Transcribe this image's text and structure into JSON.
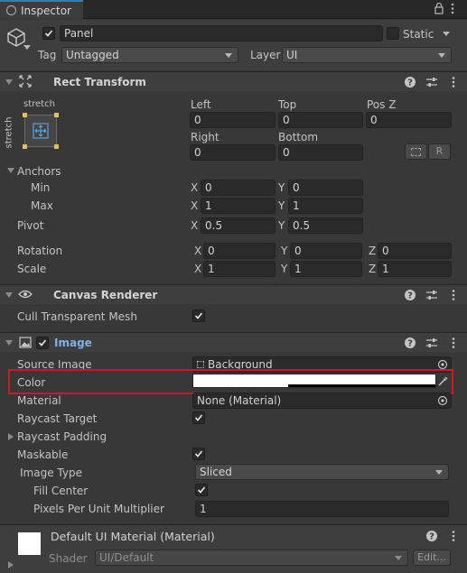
{
  "tab": {
    "title": "Inspector"
  },
  "gameobject": {
    "name": "Panel",
    "static_label": "Static",
    "tag_label": "Tag",
    "tag_value": "Untagged",
    "layer_label": "Layer",
    "layer_value": "UI"
  },
  "rect_transform": {
    "title": "Rect Transform",
    "anchor_preset_h": "stretch",
    "anchor_preset_v": "stretch",
    "left_label": "Left",
    "left_value": "0",
    "top_label": "Top",
    "top_value": "0",
    "posz_label": "Pos Z",
    "posz_value": "0",
    "right_label": "Right",
    "right_value": "0",
    "bottom_label": "Bottom",
    "bottom_value": "0",
    "r_button": "R",
    "anchors_label": "Anchors",
    "min_label": "Min",
    "min_x": "0",
    "min_y": "0",
    "max_label": "Max",
    "max_x": "1",
    "max_y": "1",
    "pivot_label": "Pivot",
    "pivot_x": "0.5",
    "pivot_y": "0.5",
    "rotation_label": "Rotation",
    "rot_x": "0",
    "rot_y": "0",
    "rot_z": "0",
    "scale_label": "Scale",
    "scale_x": "1",
    "scale_y": "1",
    "scale_z": "1",
    "x": "X",
    "y": "Y",
    "z": "Z"
  },
  "canvas_renderer": {
    "title": "Canvas Renderer",
    "cull_label": "Cull Transparent Mesh"
  },
  "image": {
    "title": "Image",
    "source_label": "Source Image",
    "source_value": "Background",
    "color_label": "Color",
    "material_label": "Material",
    "material_value": "None (Material)",
    "raycast_target_label": "Raycast Target",
    "raycast_padding_label": "Raycast Padding",
    "maskable_label": "Maskable",
    "image_type_label": "Image Type",
    "image_type_value": "Sliced",
    "fill_center_label": "Fill Center",
    "ppu_label": "Pixels Per Unit Multiplier",
    "ppu_value": "1"
  },
  "material_preview": {
    "title": "Default UI Material (Material)",
    "shader_label": "Shader",
    "shader_value": "UI/Default",
    "edit_button": "Edit..."
  },
  "colors": {
    "highlight_box": "#d0191f",
    "image_title": "#7fb0ea",
    "color_swatch": "#ffffff"
  },
  "icons": [
    "inspector-icon",
    "lock-icon",
    "menu-dots-icon",
    "cube-icon",
    "anchor-icon",
    "help-icon",
    "preset-icon",
    "eye-icon",
    "image-component-icon",
    "eyedropper-icon",
    "target-icon",
    "blueprint-icon"
  ]
}
